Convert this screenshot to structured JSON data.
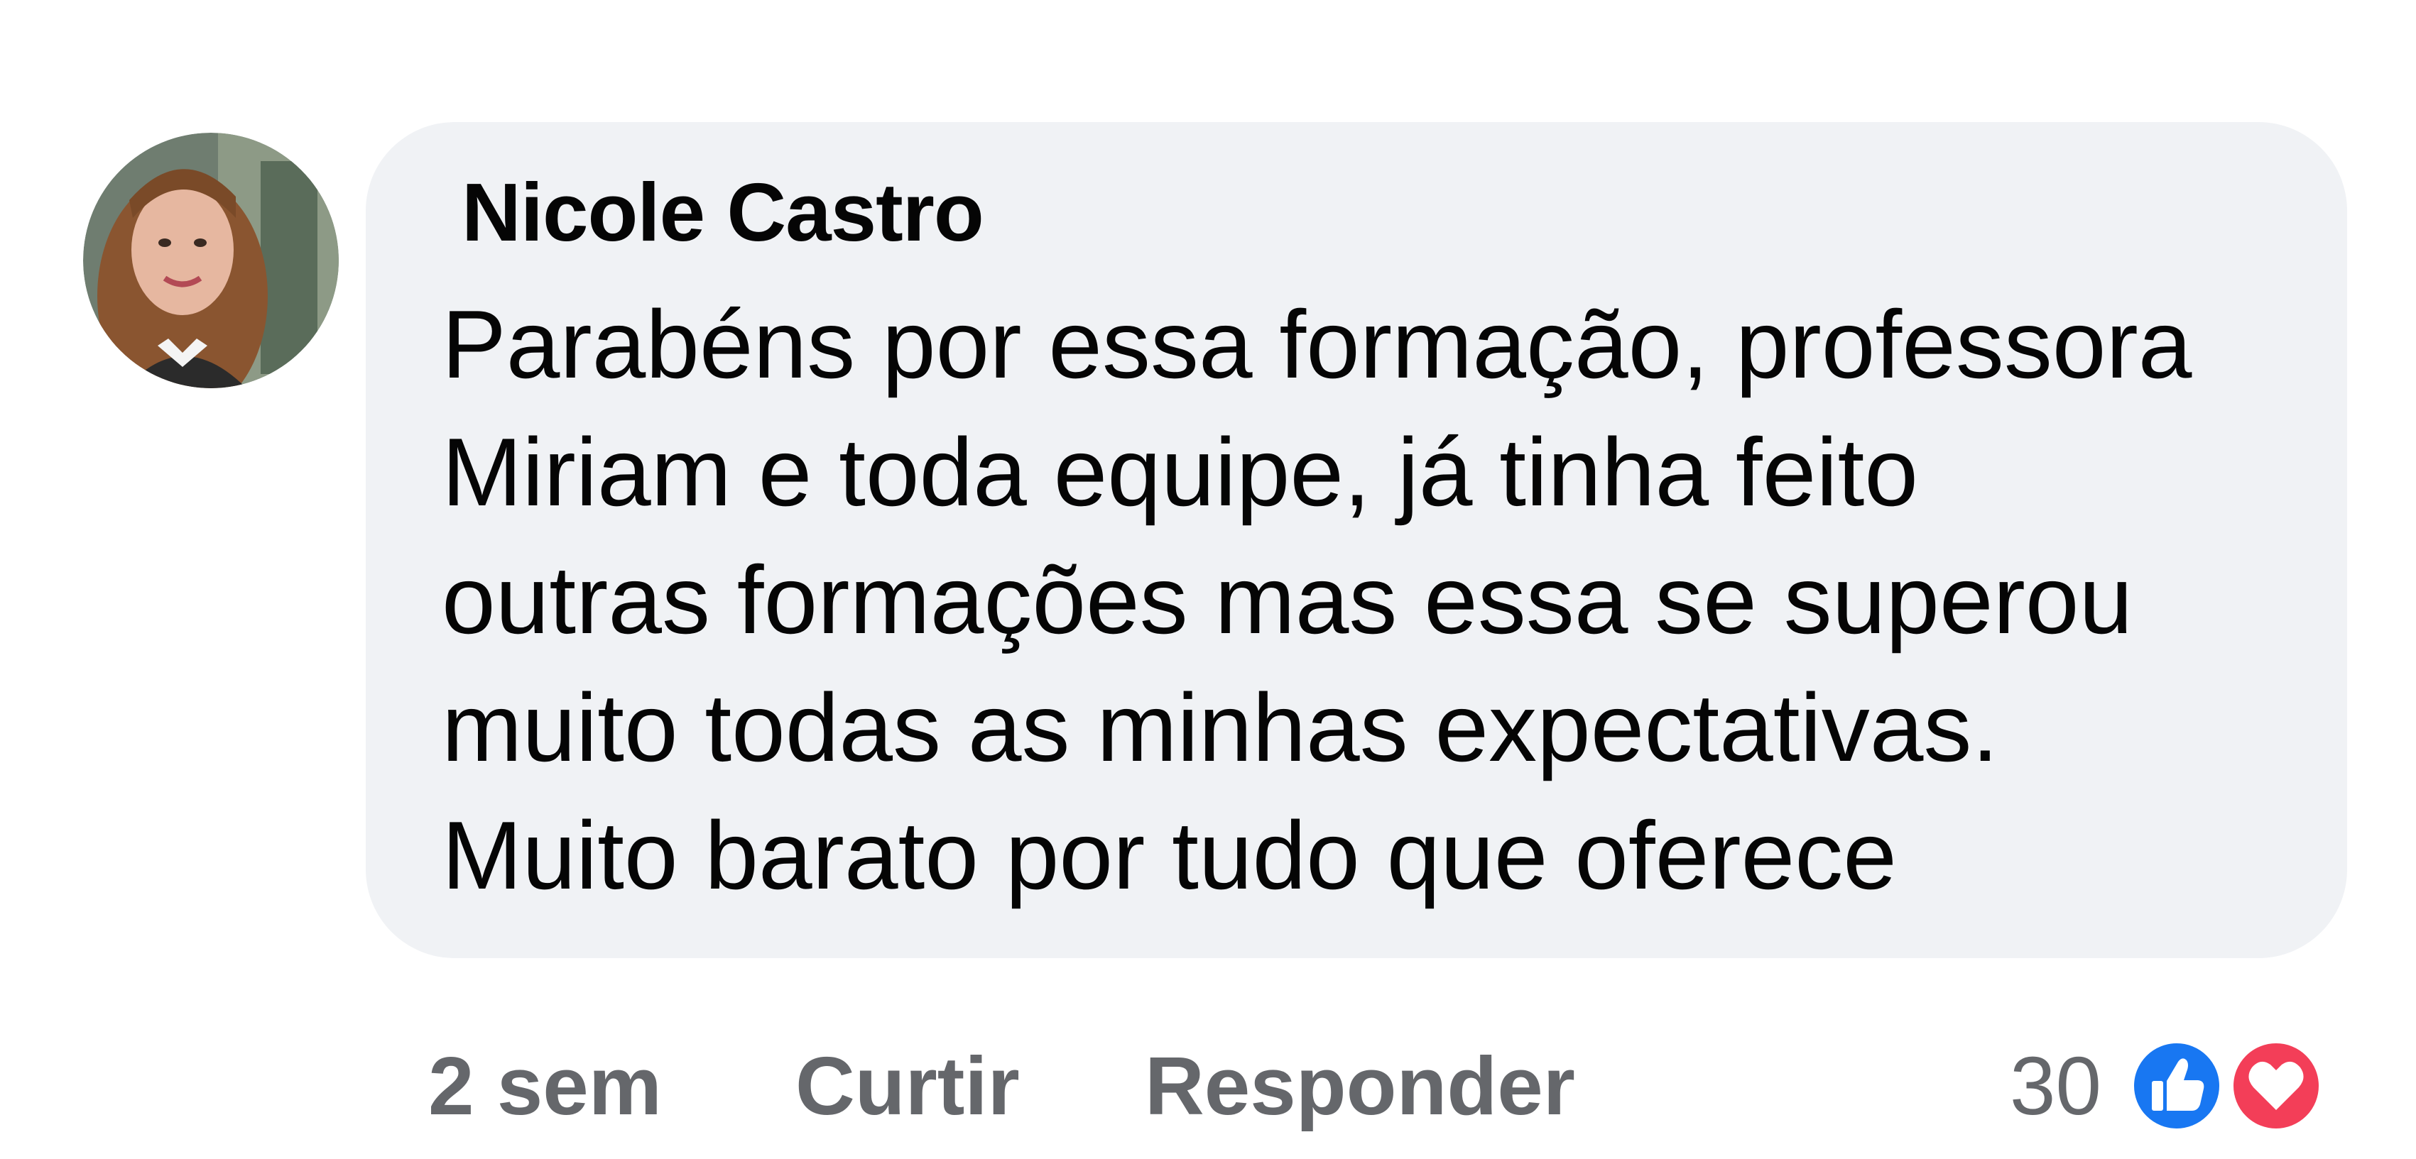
{
  "comment": {
    "author": "Nicole Castro",
    "text": "Parabéns por essa formação, professora\nMiriam e toda equipe, já tinha feito\noutras formações mas essa se superou\nmuito todas as minhas expectativas.\nMuito barato por tudo que oferece",
    "avatar_icon": "profile-photo",
    "bubble_color": "#f0f2f5"
  },
  "actions": {
    "time": "2 sem",
    "like_label": "Curtir",
    "reply_label": "Responder"
  },
  "reactions": {
    "count": "30",
    "types": [
      "like-icon",
      "love-icon"
    ],
    "like_color": "#1877f2",
    "love_color": "#f33e58"
  }
}
